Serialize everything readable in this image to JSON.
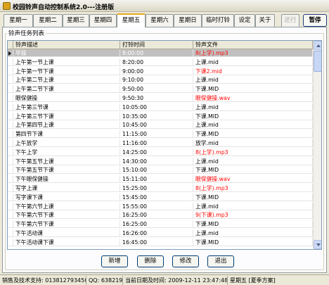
{
  "window": {
    "title": "校园铃声自动控制系统2.0---注册版"
  },
  "tabs": [
    {
      "label": "星期一"
    },
    {
      "label": "星期二"
    },
    {
      "label": "星期三"
    },
    {
      "label": "星期四"
    },
    {
      "label": "星期五"
    },
    {
      "label": "星期六"
    },
    {
      "label": "星期日"
    },
    {
      "label": "临时打铃"
    },
    {
      "label": "设定"
    },
    {
      "label": "关于"
    },
    {
      "label": "还行"
    }
  ],
  "active_tab": "星期五",
  "pause_button": "暂停",
  "group_label": "铃声任务列表",
  "columns": [
    "铃声描述",
    "打铃时间",
    "铃声文件"
  ],
  "rows": [
    {
      "desc": "早操",
      "time": "8:00:00",
      "file": "8(上学).mp3",
      "file_red": true,
      "selected": true
    },
    {
      "desc": "上午第一节上课",
      "time": "8:20:00",
      "file": "上课.mid"
    },
    {
      "desc": "上午第一节下课",
      "time": "9:00:00",
      "file": "下课2.mid",
      "file_red": true
    },
    {
      "desc": "上午第二节上课",
      "time": "9:10:00",
      "file": "上课.mid"
    },
    {
      "desc": "上午第二节下课",
      "time": "9:50:00",
      "file": "下课.MID"
    },
    {
      "desc": "眼保健操",
      "time": "9:50:30",
      "file": "眼保健操.wav",
      "file_red": true
    },
    {
      "desc": "上午第三节课",
      "time": "10:05:00",
      "file": "上课.mid"
    },
    {
      "desc": "上午第三节下课",
      "time": "10:35:00",
      "file": "下课.MID"
    },
    {
      "desc": "上午第四节上课",
      "time": "10:45:00",
      "file": "上课.mid"
    },
    {
      "desc": "第四节下课",
      "time": "11:15:00",
      "file": "下课.MID"
    },
    {
      "desc": "上午放学",
      "time": "11:16:00",
      "file": "放学.mid"
    },
    {
      "desc": "下午上学",
      "time": "14:25:00",
      "file": "8(上学).mp3",
      "file_red": true
    },
    {
      "desc": "下午第五节上课",
      "time": "14:30:00",
      "file": "上课.mid"
    },
    {
      "desc": "下午第五节下课",
      "time": "15:10:00",
      "file": "下课.MID"
    },
    {
      "desc": "下午眼保健操",
      "time": "15:11:00",
      "file": "眼保健操.wav",
      "file_red": true
    },
    {
      "desc": "写字上课",
      "time": "15:25:00",
      "file": "8(上学).mp3",
      "file_red": true
    },
    {
      "desc": "写字课下课",
      "time": "15:45:00",
      "file": "下课.MID"
    },
    {
      "desc": "下午第六节上课",
      "time": "15:55:00",
      "file": "上课.mid"
    },
    {
      "desc": "下午第六节下课",
      "time": "16:25:00",
      "file": "9(下课).mp3",
      "file_red": true
    },
    {
      "desc": "下午第六节下课",
      "time": "16:25:00",
      "file": "下课.MID"
    },
    {
      "desc": "下午活动课",
      "time": "16:26:00",
      "file": "上课.mid"
    },
    {
      "desc": "下午活动课下课",
      "time": "16:45:00",
      "file": "下课.MID"
    }
  ],
  "buttons": {
    "add": "新增",
    "delete": "删除",
    "edit": "修改",
    "exit": "退出"
  },
  "status": {
    "support": "销售及技术支持: 013812793450",
    "qq": "QQ: 638219",
    "datetime": "当前日期及时间: 2009-12-11 23:47:48",
    "weekday": "星期五 [夏季方案]"
  }
}
